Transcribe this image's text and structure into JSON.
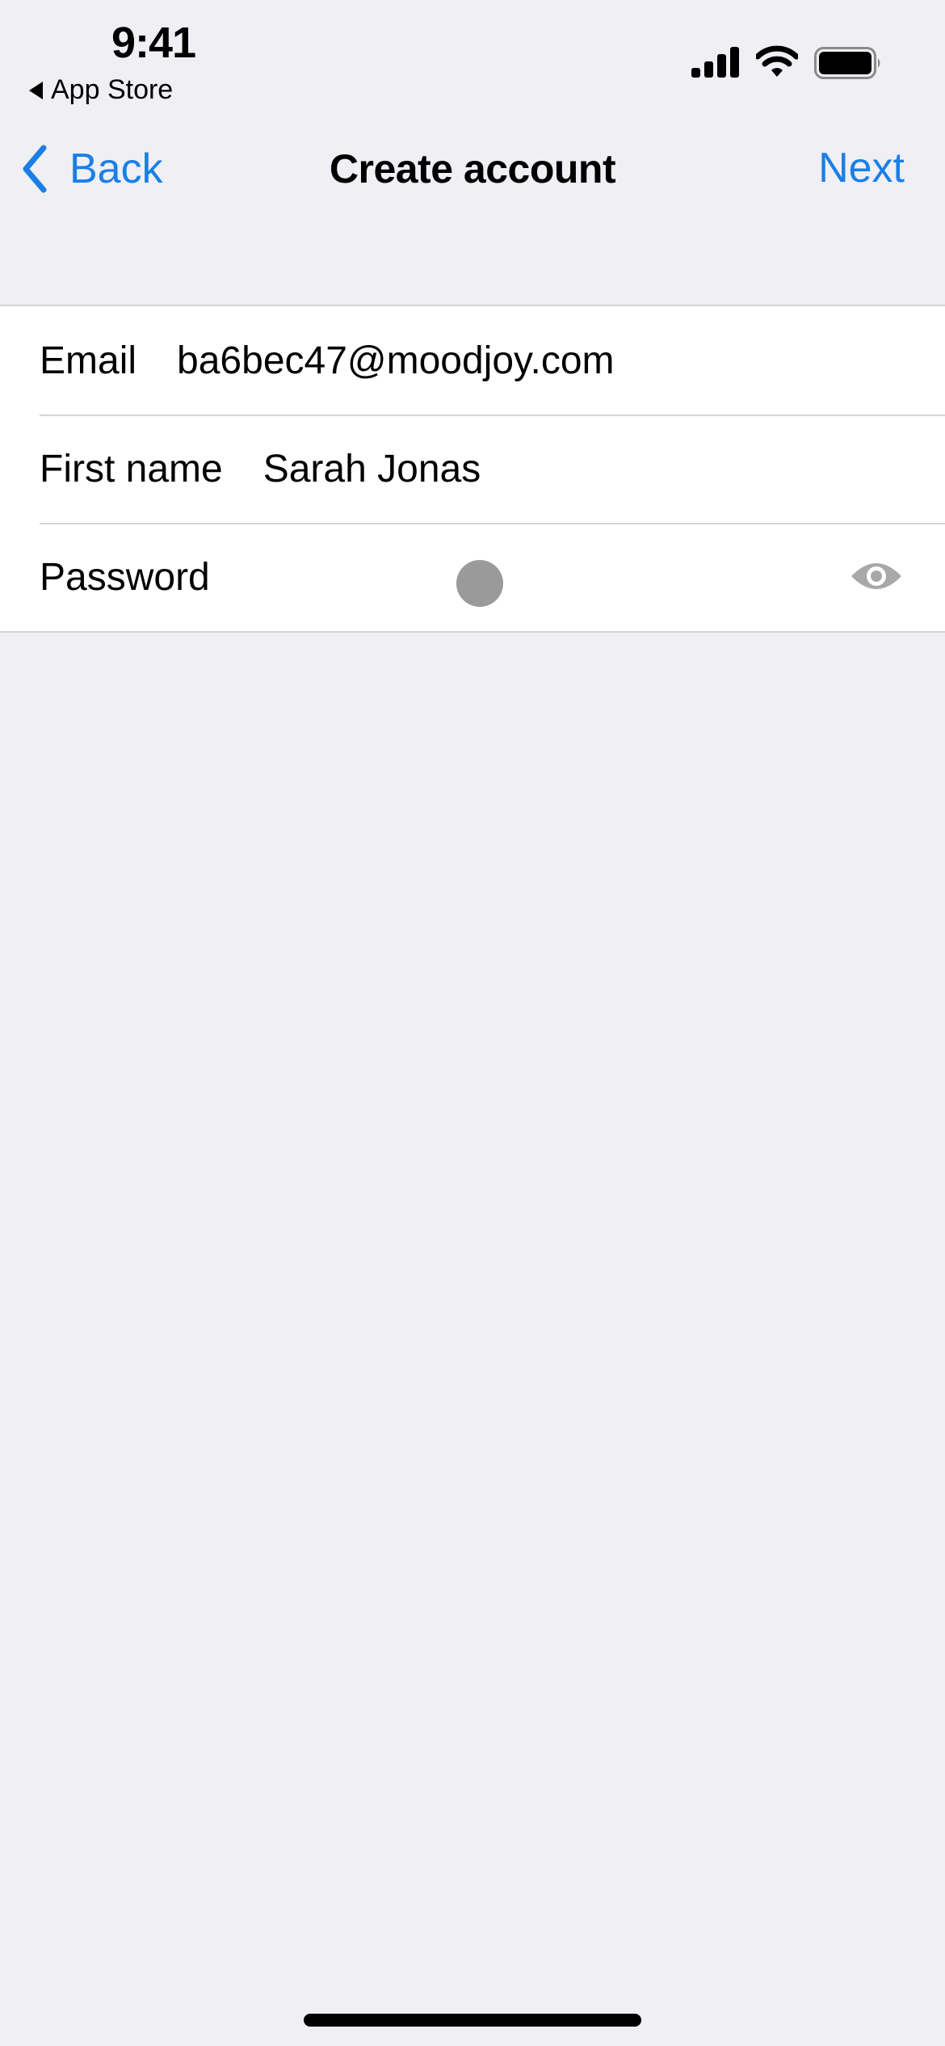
{
  "status_bar": {
    "time": "9:41",
    "back_to_app": "App Store",
    "icons": [
      "cellular-signal-icon",
      "wifi-icon",
      "battery-icon"
    ]
  },
  "nav": {
    "back_label": "Back",
    "title": "Create account",
    "next_label": "Next",
    "accent_color": "#1a7fe6"
  },
  "form": {
    "rows": [
      {
        "label": "Email",
        "value": "ba6bec47@moodjoy.com"
      },
      {
        "label": "First name",
        "value": "Sarah Jonas"
      },
      {
        "label": "Password",
        "value": "",
        "toggle_icon": "eye-icon"
      }
    ]
  }
}
